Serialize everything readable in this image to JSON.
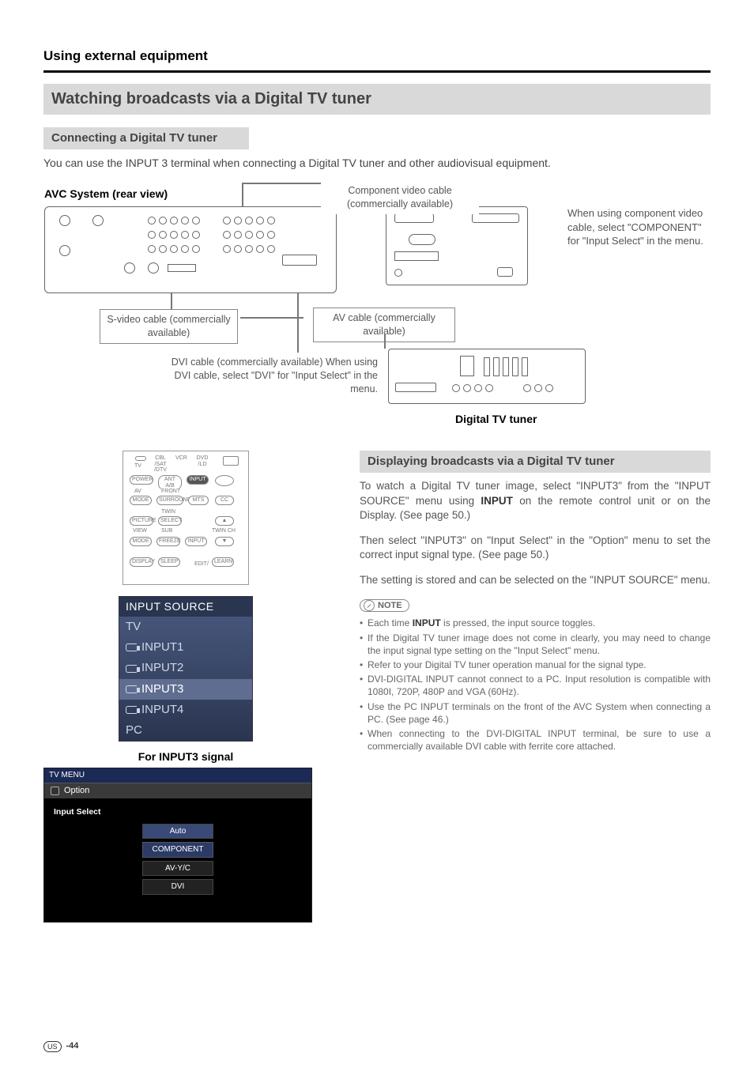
{
  "breadcrumb": "Using external equipment",
  "title_bar": "Watching broadcasts via a Digital TV tuner",
  "sub_connect": "Connecting a Digital TV tuner",
  "intro": "You can use the INPUT 3 terminal when connecting a Digital TV tuner and other audiovisual equipment.",
  "diagram": {
    "avc_label": "AVC System (rear view)",
    "component_cable": "Component video cable (commercially available)",
    "svideo_cable": "S-video cable (commercially available)",
    "av_cable": "AV cable (commercially available)",
    "dvi_cable": "DVI cable (commercially available) When using DVI cable, select \"DVI\" for \"Input Select\" in the menu.",
    "side_note": "When using component video cable, select \"COMPONENT\" for \"Input Select\" in the menu.",
    "dtv_label": "Digital TV tuner"
  },
  "remote_labels": {
    "tv": "TV",
    "cbl": "CBL /SAT /DTV",
    "vcr": "VCR",
    "dvd": "DVD /LD",
    "power": "POWER",
    "ant": "ANT A/B",
    "input": "INPUT",
    "light": "",
    "av": "AV",
    "front": "FRONT",
    "mode": "MODE",
    "surround": "SURROUND",
    "mts": "MTS",
    "cc": "CC",
    "twin": "TWIN",
    "picture": "PICTURE",
    "select": "SELECT",
    "sub": "SUB",
    "twinch": "TWIN CH",
    "view": "VIEW",
    "freeze": "FREEZE",
    "input2": "INPUT",
    "mode2": "MODE",
    "display": "DISPLAY",
    "sleep": "SLEEP",
    "edit": "EDIT/",
    "learn": "LEARN"
  },
  "osd": {
    "header": "INPUT SOURCE",
    "rows": [
      "TV",
      "INPUT1",
      "INPUT2",
      "INPUT3",
      "INPUT4",
      "PC"
    ],
    "selected": "INPUT3"
  },
  "caption_input3": "For INPUT3 signal",
  "tvmenu": {
    "title": "TV MENU",
    "tab": "Option",
    "label": "Input Select",
    "options": [
      "Auto",
      "COMPONENT",
      "AV-Y/C",
      "DVI"
    ],
    "selected": "COMPONENT"
  },
  "sub_display": "Displaying broadcasts via a Digital TV tuner",
  "para1_a": "To watch a Digital TV tuner image, select \"INPUT3\" from the \"INPUT SOURCE\" menu using ",
  "para1_bold": "INPUT",
  "para1_b": " on the remote control unit or on the Display. (See page 50.)",
  "para2": "Then select \"INPUT3\" on \"Input Select\" in the \"Option\" menu to set the correct input signal type. (See page 50.)",
  "para3": "The setting is stored and can be selected on the \"INPUT SOURCE\" menu.",
  "note_label": "NOTE",
  "notes": [
    {
      "pre": "Each time ",
      "bold": "INPUT",
      "post": " is pressed, the input source toggles."
    },
    {
      "text": "If the Digital TV tuner image does not come in clearly, you may need to change the input signal type setting on the \"Input Select\" menu."
    },
    {
      "text": "Refer to your Digital TV tuner operation manual for the signal type."
    },
    {
      "text": "DVI-DIGITAL INPUT cannot connect to a PC. Input resolution is compatible with 1080I, 720P, 480P and VGA (60Hz)."
    },
    {
      "text": "Use the PC INPUT terminals on the front of the AVC System when connecting a PC. (See page 46.)"
    },
    {
      "text": "When connecting to the DVI-DIGITAL INPUT terminal, be sure to use a commercially available DVI cable with ferrite core attached."
    }
  ],
  "footer": {
    "region": "US",
    "page": "-44"
  }
}
